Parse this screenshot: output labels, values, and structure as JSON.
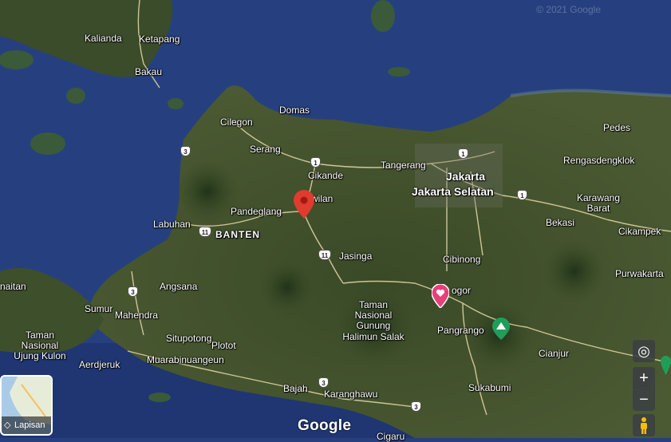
{
  "map": {
    "copyright": "© 2021 Google",
    "watermark": "Google",
    "logo": "Google",
    "layers_label": "Lapisan",
    "colors": {
      "sea": "#26407f",
      "land": "#3d4f2a",
      "road": "#e8d9a8",
      "pin_red": "#e03b2f",
      "pin_pink": "#e6407a",
      "park_green": "#1f9e5a"
    }
  },
  "places": {
    "kalianda": "Kalianda",
    "ketapang": "Ketapang",
    "bakau": "Bakau",
    "cilegon": "Cilegon",
    "domas": "Domas",
    "serang": "Serang",
    "cikande": "Cikande",
    "tangerang": "Tangerang",
    "jakarta": "Jakarta",
    "jakarta_selatan": "Jakarta Selatan",
    "pedes": "Pedes",
    "rengasdengklok": "Rengasdengklok",
    "karawang_barat": "Karawang\nBarat",
    "bekasi": "Bekasi",
    "cikampek": "Cikampek",
    "purwakarta": "Purwakarta",
    "labuhan": "Labuhan",
    "pandeglang": "Pandeglang",
    "banten": "BANTEN",
    "wilan": "wilan",
    "jasinga": "Jasinga",
    "cibinong": "Cibinong",
    "bogor": "ogor",
    "angsana": "Angsana",
    "sumur": "Sumur",
    "mahendra": "Mahendra",
    "taman_nasional_gunung": "Taman\nNasional\nGunung\nHalimun Salak",
    "pangrango": "Pangrango",
    "cianjur": "Cianjur",
    "sukabumi": "Sukabumi",
    "citupotong": "Situpotong",
    "plotot": "Plotot",
    "muarabinuangeun": "Muarabinuangeun",
    "aerdjeruk": "Aerdjeruk",
    "taman_ujung_kulon": "Taman\nNasional\nUjung Kulon",
    "naitan": "naitan",
    "bajah": "Bajah",
    "karanghawu": "Karanghawu",
    "cigaru": "Cigaru"
  },
  "road_shields": [
    "1",
    "1",
    "1",
    "3",
    "3",
    "11",
    "11",
    "3",
    "3"
  ],
  "controls": {
    "my_location": "◎",
    "zoom_in": "+",
    "zoom_out": "−"
  }
}
